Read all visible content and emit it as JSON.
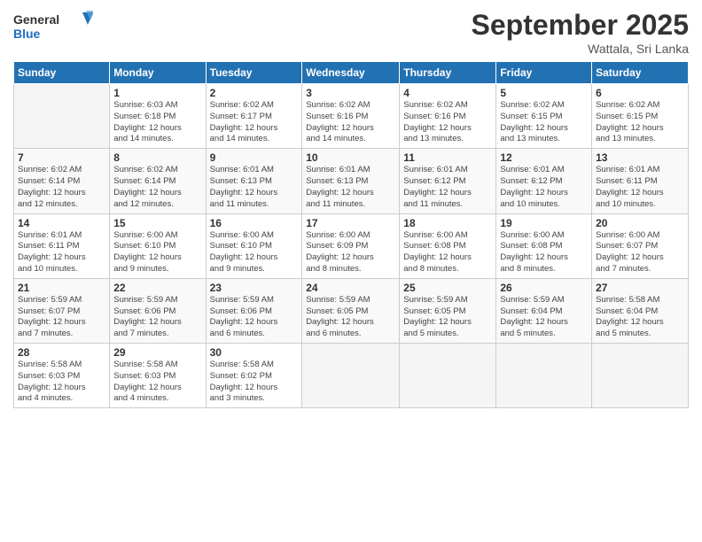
{
  "logo": {
    "line1": "General",
    "line2": "Blue"
  },
  "title": "September 2025",
  "subtitle": "Wattala, Sri Lanka",
  "days_of_week": [
    "Sunday",
    "Monday",
    "Tuesday",
    "Wednesday",
    "Thursday",
    "Friday",
    "Saturday"
  ],
  "weeks": [
    [
      {
        "num": "",
        "info": ""
      },
      {
        "num": "1",
        "info": "Sunrise: 6:03 AM\nSunset: 6:18 PM\nDaylight: 12 hours\nand 14 minutes."
      },
      {
        "num": "2",
        "info": "Sunrise: 6:02 AM\nSunset: 6:17 PM\nDaylight: 12 hours\nand 14 minutes."
      },
      {
        "num": "3",
        "info": "Sunrise: 6:02 AM\nSunset: 6:16 PM\nDaylight: 12 hours\nand 14 minutes."
      },
      {
        "num": "4",
        "info": "Sunrise: 6:02 AM\nSunset: 6:16 PM\nDaylight: 12 hours\nand 13 minutes."
      },
      {
        "num": "5",
        "info": "Sunrise: 6:02 AM\nSunset: 6:15 PM\nDaylight: 12 hours\nand 13 minutes."
      },
      {
        "num": "6",
        "info": "Sunrise: 6:02 AM\nSunset: 6:15 PM\nDaylight: 12 hours\nand 13 minutes."
      }
    ],
    [
      {
        "num": "7",
        "info": "Sunrise: 6:02 AM\nSunset: 6:14 PM\nDaylight: 12 hours\nand 12 minutes."
      },
      {
        "num": "8",
        "info": "Sunrise: 6:02 AM\nSunset: 6:14 PM\nDaylight: 12 hours\nand 12 minutes."
      },
      {
        "num": "9",
        "info": "Sunrise: 6:01 AM\nSunset: 6:13 PM\nDaylight: 12 hours\nand 11 minutes."
      },
      {
        "num": "10",
        "info": "Sunrise: 6:01 AM\nSunset: 6:13 PM\nDaylight: 12 hours\nand 11 minutes."
      },
      {
        "num": "11",
        "info": "Sunrise: 6:01 AM\nSunset: 6:12 PM\nDaylight: 12 hours\nand 11 minutes."
      },
      {
        "num": "12",
        "info": "Sunrise: 6:01 AM\nSunset: 6:12 PM\nDaylight: 12 hours\nand 10 minutes."
      },
      {
        "num": "13",
        "info": "Sunrise: 6:01 AM\nSunset: 6:11 PM\nDaylight: 12 hours\nand 10 minutes."
      }
    ],
    [
      {
        "num": "14",
        "info": "Sunrise: 6:01 AM\nSunset: 6:11 PM\nDaylight: 12 hours\nand 10 minutes."
      },
      {
        "num": "15",
        "info": "Sunrise: 6:00 AM\nSunset: 6:10 PM\nDaylight: 12 hours\nand 9 minutes."
      },
      {
        "num": "16",
        "info": "Sunrise: 6:00 AM\nSunset: 6:10 PM\nDaylight: 12 hours\nand 9 minutes."
      },
      {
        "num": "17",
        "info": "Sunrise: 6:00 AM\nSunset: 6:09 PM\nDaylight: 12 hours\nand 8 minutes."
      },
      {
        "num": "18",
        "info": "Sunrise: 6:00 AM\nSunset: 6:08 PM\nDaylight: 12 hours\nand 8 minutes."
      },
      {
        "num": "19",
        "info": "Sunrise: 6:00 AM\nSunset: 6:08 PM\nDaylight: 12 hours\nand 8 minutes."
      },
      {
        "num": "20",
        "info": "Sunrise: 6:00 AM\nSunset: 6:07 PM\nDaylight: 12 hours\nand 7 minutes."
      }
    ],
    [
      {
        "num": "21",
        "info": "Sunrise: 5:59 AM\nSunset: 6:07 PM\nDaylight: 12 hours\nand 7 minutes."
      },
      {
        "num": "22",
        "info": "Sunrise: 5:59 AM\nSunset: 6:06 PM\nDaylight: 12 hours\nand 7 minutes."
      },
      {
        "num": "23",
        "info": "Sunrise: 5:59 AM\nSunset: 6:06 PM\nDaylight: 12 hours\nand 6 minutes."
      },
      {
        "num": "24",
        "info": "Sunrise: 5:59 AM\nSunset: 6:05 PM\nDaylight: 12 hours\nand 6 minutes."
      },
      {
        "num": "25",
        "info": "Sunrise: 5:59 AM\nSunset: 6:05 PM\nDaylight: 12 hours\nand 5 minutes."
      },
      {
        "num": "26",
        "info": "Sunrise: 5:59 AM\nSunset: 6:04 PM\nDaylight: 12 hours\nand 5 minutes."
      },
      {
        "num": "27",
        "info": "Sunrise: 5:58 AM\nSunset: 6:04 PM\nDaylight: 12 hours\nand 5 minutes."
      }
    ],
    [
      {
        "num": "28",
        "info": "Sunrise: 5:58 AM\nSunset: 6:03 PM\nDaylight: 12 hours\nand 4 minutes."
      },
      {
        "num": "29",
        "info": "Sunrise: 5:58 AM\nSunset: 6:03 PM\nDaylight: 12 hours\nand 4 minutes."
      },
      {
        "num": "30",
        "info": "Sunrise: 5:58 AM\nSunset: 6:02 PM\nDaylight: 12 hours\nand 3 minutes."
      },
      {
        "num": "",
        "info": ""
      },
      {
        "num": "",
        "info": ""
      },
      {
        "num": "",
        "info": ""
      },
      {
        "num": "",
        "info": ""
      }
    ]
  ]
}
